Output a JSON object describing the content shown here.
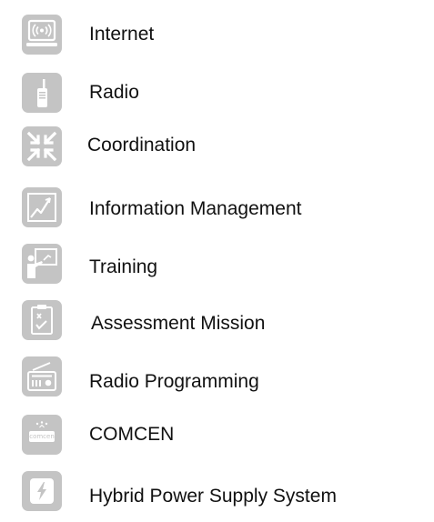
{
  "legend": {
    "icon_color": "#c4c4c4",
    "items": [
      {
        "label": "Internet",
        "icon": "internet-icon"
      },
      {
        "label": "Radio",
        "icon": "handheld-radio-icon"
      },
      {
        "label": "Coordination",
        "icon": "coordination-arrows-icon"
      },
      {
        "label": "Information Management",
        "icon": "line-chart-icon"
      },
      {
        "label": "Training",
        "icon": "training-presenter-icon"
      },
      {
        "label": "Assessment Mission",
        "icon": "checklist-icon"
      },
      {
        "label": "Radio Programming",
        "icon": "radio-receiver-icon"
      },
      {
        "label": "COMCEN",
        "icon": "comcen-icon",
        "icon_text": "comcen"
      },
      {
        "label": "Hybrid Power Supply System",
        "icon": "power-bolt-icon"
      }
    ]
  }
}
